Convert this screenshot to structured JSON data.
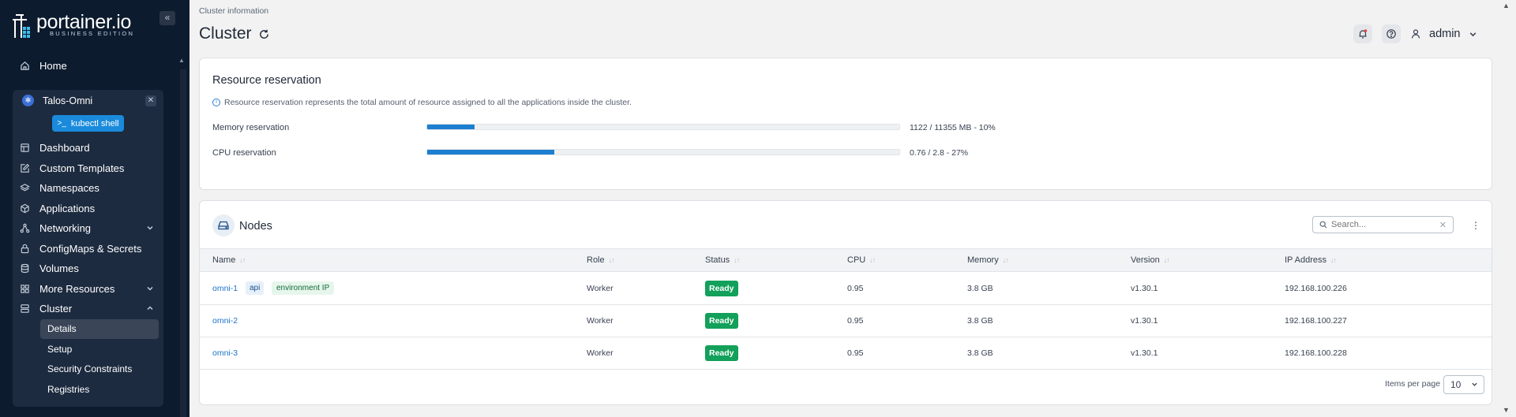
{
  "brand": {
    "name": "portainer.io",
    "edition": "BUSINESS EDITION"
  },
  "sidebar": {
    "home_label": "Home",
    "environment": {
      "name": "Talos-Omni",
      "kubectl_label": "kubectl shell",
      "items": [
        {
          "label": "Dashboard",
          "icon": "dashboard-icon"
        },
        {
          "label": "Custom Templates",
          "icon": "edit-icon"
        },
        {
          "label": "Namespaces",
          "icon": "layers-icon"
        },
        {
          "label": "Applications",
          "icon": "box-icon"
        },
        {
          "label": "Networking",
          "icon": "network-icon",
          "expandable": true
        },
        {
          "label": "ConfigMaps & Secrets",
          "icon": "lock-icon"
        },
        {
          "label": "Volumes",
          "icon": "database-icon"
        },
        {
          "label": "More Resources",
          "icon": "grid-icon",
          "expandable": true
        },
        {
          "label": "Cluster",
          "icon": "server-icon",
          "expanded": true
        }
      ],
      "cluster_subitems": [
        {
          "label": "Details",
          "active": true
        },
        {
          "label": "Setup"
        },
        {
          "label": "Security Constraints"
        },
        {
          "label": "Registries"
        }
      ]
    }
  },
  "header": {
    "breadcrumb": "Cluster information",
    "title": "Cluster",
    "user_name": "admin"
  },
  "resource_reservation": {
    "title": "Resource reservation",
    "info": "Resource reservation represents the total amount of resource assigned to all the applications inside the cluster.",
    "memory": {
      "label": "Memory reservation",
      "value_text": "1122 / 11355 MB - 10%",
      "percent": 10
    },
    "cpu": {
      "label": "CPU reservation",
      "value_text": "0.76 / 2.8 - 27%",
      "percent": 27
    }
  },
  "nodes": {
    "title": "Nodes",
    "search_placeholder": "Search...",
    "columns": [
      "Name",
      "Role",
      "Status",
      "CPU",
      "Memory",
      "Version",
      "IP Address"
    ],
    "rows": [
      {
        "name": "omni-1",
        "tags": [
          "api",
          "environment IP"
        ],
        "role": "Worker",
        "status": "Ready",
        "cpu": "0.95",
        "memory": "3.8 GB",
        "version": "v1.30.1",
        "ip": "192.168.100.226"
      },
      {
        "name": "omni-2",
        "tags": [],
        "role": "Worker",
        "status": "Ready",
        "cpu": "0.95",
        "memory": "3.8 GB",
        "version": "v1.30.1",
        "ip": "192.168.100.227"
      },
      {
        "name": "omni-3",
        "tags": [],
        "role": "Worker",
        "status": "Ready",
        "cpu": "0.95",
        "memory": "3.8 GB",
        "version": "v1.30.1",
        "ip": "192.168.100.228"
      }
    ],
    "items_per_page_label": "Items per page",
    "items_per_page": "10"
  },
  "colors": {
    "accent": "#1c7fd0",
    "sidebar_bg": "#0d1b2e",
    "ready": "#12a05a"
  }
}
